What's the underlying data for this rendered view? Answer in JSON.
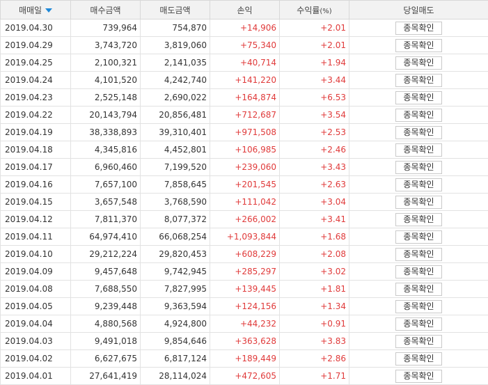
{
  "columns": {
    "date": "매매일",
    "buy": "매수금액",
    "sell": "매도금액",
    "profit": "손익",
    "rate": "수익률",
    "rate_unit": "(%)",
    "check": "당일매도"
  },
  "sort_icon": "triangle-down-icon",
  "button_label": "종목확인",
  "colors": {
    "profit": "#e03a3a",
    "sort": "#1e88d8"
  },
  "rows": [
    {
      "date": "2019.04.30",
      "buy": "739,964",
      "sell": "754,870",
      "profit": "+14,906",
      "rate": "+2.01"
    },
    {
      "date": "2019.04.29",
      "buy": "3,743,720",
      "sell": "3,819,060",
      "profit": "+75,340",
      "rate": "+2.01"
    },
    {
      "date": "2019.04.25",
      "buy": "2,100,321",
      "sell": "2,141,035",
      "profit": "+40,714",
      "rate": "+1.94"
    },
    {
      "date": "2019.04.24",
      "buy": "4,101,520",
      "sell": "4,242,740",
      "profit": "+141,220",
      "rate": "+3.44"
    },
    {
      "date": "2019.04.23",
      "buy": "2,525,148",
      "sell": "2,690,022",
      "profit": "+164,874",
      "rate": "+6.53"
    },
    {
      "date": "2019.04.22",
      "buy": "20,143,794",
      "sell": "20,856,481",
      "profit": "+712,687",
      "rate": "+3.54"
    },
    {
      "date": "2019.04.19",
      "buy": "38,338,893",
      "sell": "39,310,401",
      "profit": "+971,508",
      "rate": "+2.53"
    },
    {
      "date": "2019.04.18",
      "buy": "4,345,816",
      "sell": "4,452,801",
      "profit": "+106,985",
      "rate": "+2.46"
    },
    {
      "date": "2019.04.17",
      "buy": "6,960,460",
      "sell": "7,199,520",
      "profit": "+239,060",
      "rate": "+3.43"
    },
    {
      "date": "2019.04.16",
      "buy": "7,657,100",
      "sell": "7,858,645",
      "profit": "+201,545",
      "rate": "+2.63"
    },
    {
      "date": "2019.04.15",
      "buy": "3,657,548",
      "sell": "3,768,590",
      "profit": "+111,042",
      "rate": "+3.04"
    },
    {
      "date": "2019.04.12",
      "buy": "7,811,370",
      "sell": "8,077,372",
      "profit": "+266,002",
      "rate": "+3.41"
    },
    {
      "date": "2019.04.11",
      "buy": "64,974,410",
      "sell": "66,068,254",
      "profit": "+1,093,844",
      "rate": "+1.68"
    },
    {
      "date": "2019.04.10",
      "buy": "29,212,224",
      "sell": "29,820,453",
      "profit": "+608,229",
      "rate": "+2.08"
    },
    {
      "date": "2019.04.09",
      "buy": "9,457,648",
      "sell": "9,742,945",
      "profit": "+285,297",
      "rate": "+3.02"
    },
    {
      "date": "2019.04.08",
      "buy": "7,688,550",
      "sell": "7,827,995",
      "profit": "+139,445",
      "rate": "+1.81"
    },
    {
      "date": "2019.04.05",
      "buy": "9,239,448",
      "sell": "9,363,594",
      "profit": "+124,156",
      "rate": "+1.34"
    },
    {
      "date": "2019.04.04",
      "buy": "4,880,568",
      "sell": "4,924,800",
      "profit": "+44,232",
      "rate": "+0.91"
    },
    {
      "date": "2019.04.03",
      "buy": "9,491,018",
      "sell": "9,854,646",
      "profit": "+363,628",
      "rate": "+3.83"
    },
    {
      "date": "2019.04.02",
      "buy": "6,627,675",
      "sell": "6,817,124",
      "profit": "+189,449",
      "rate": "+2.86"
    },
    {
      "date": "2019.04.01",
      "buy": "27,641,419",
      "sell": "28,114,024",
      "profit": "+472,605",
      "rate": "+1.71"
    }
  ]
}
